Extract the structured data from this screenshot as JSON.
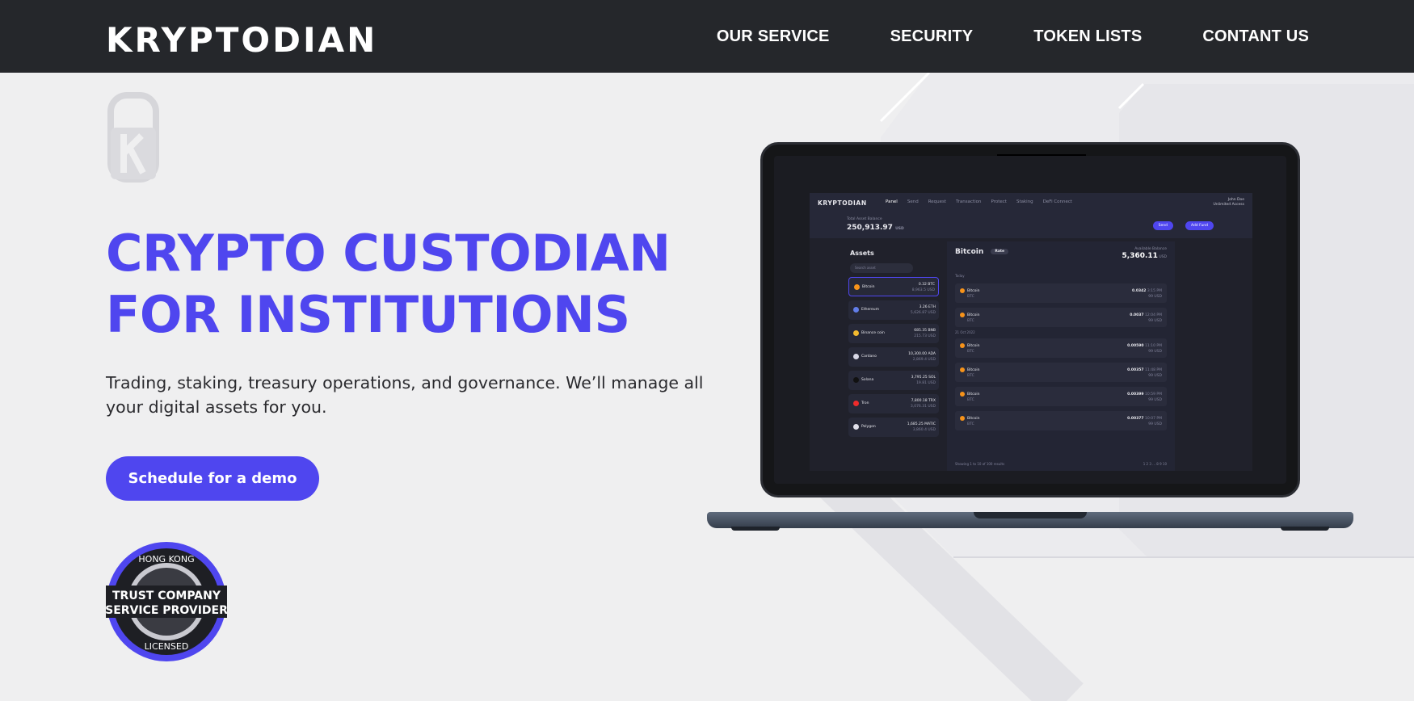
{
  "brand": {
    "logo_text": "KRYPTODIAN",
    "accent": "#4f46ef",
    "header_bg": "#25272b"
  },
  "nav": {
    "items": [
      {
        "label": "OUR SERVICE"
      },
      {
        "label": "SECURITY"
      },
      {
        "label": "TOKEN LISTS"
      },
      {
        "label": "CONTANT US"
      }
    ]
  },
  "hero": {
    "title_line1": "CRYPTO CUSTODIAN",
    "title_line2": "FOR INSTITUTIONS",
    "subtitle": "Trading, staking, treasury operations, and governance. We’ll manage all your digital assets for you.",
    "cta_label": "Schedule for a demo"
  },
  "badge": {
    "top_text": "HONG KONG",
    "line1": "TRUST COMPANY",
    "line2": "SERVICE PROVIDER",
    "bottom_text": "LICENSED"
  },
  "laptop_app": {
    "logo": "KRYPTODIAN",
    "tabs": [
      "Panel",
      "Send",
      "Request",
      "Transaction",
      "Protect",
      "Staking",
      "DeFi Connect"
    ],
    "user_name": "John Doe",
    "user_role": "Unlimited Access",
    "balance_label": "Total Asset Balance",
    "balance_value": "250,913.97",
    "balance_unit": "USD",
    "send_label": "Send",
    "add_fund_label": "Add Fund",
    "assets_title": "Assets",
    "search_placeholder": "Search asset",
    "assets": [
      {
        "name": "Bitcoin",
        "amount": "0.32 BTC",
        "usd": "8,963.5 USD",
        "color": "#f7931a"
      },
      {
        "name": "Ethereum",
        "amount": "3.26 ETH",
        "usd": "5,626.87 USD",
        "color": "#627eea"
      },
      {
        "name": "Binance coin",
        "amount": "685.35 BNB",
        "usd": "215.73 USD",
        "color": "#f3ba2f"
      },
      {
        "name": "Cardano",
        "amount": "10,300.00 ADA",
        "usd": "2,869.4 USD",
        "color": "#d8d8e6"
      },
      {
        "name": "Solana",
        "amount": "3,795.25 SOL",
        "usd": "19.81 USD",
        "color": "#111111"
      },
      {
        "name": "Tron",
        "amount": "7,800.18 TRX",
        "usd": "3,076.31 USD",
        "color": "#ef2b2b"
      },
      {
        "name": "Polygon",
        "amount": "1,685.25 MATIC",
        "usd": "3,860.4 USD",
        "color": "#e0e0ea"
      }
    ],
    "detail_title": "Bitcoin",
    "detail_tag": "Rate",
    "available_label": "Available Balance",
    "available_value": "5,360.11",
    "available_unit": "USD",
    "group_today": "Today",
    "group_date": "21 Oct 2022",
    "transactions": [
      {
        "name": "Bitcoin",
        "sub": "BTC",
        "amount": "0.0342",
        "time": "3:15 PM",
        "usd": "99 USD"
      },
      {
        "name": "Bitcoin",
        "sub": "BTC",
        "amount": "0.0037",
        "time": "12:04 PM",
        "usd": "99 USD"
      },
      {
        "name": "Bitcoin",
        "sub": "BTC",
        "amount": "0.00590",
        "time": "11:10 PM",
        "usd": "99 USD"
      },
      {
        "name": "Bitcoin",
        "sub": "BTC",
        "amount": "0.00357",
        "time": "11:48 PM",
        "usd": "99 USD"
      },
      {
        "name": "Bitcoin",
        "sub": "BTC",
        "amount": "0.00399",
        "time": "10:59 PM",
        "usd": "99 USD"
      },
      {
        "name": "Bitcoin",
        "sub": "BTC",
        "amount": "0.00377",
        "time": "10:07 PM",
        "usd": "99 USD"
      }
    ],
    "pager_text": "Showing 1 to 10 of 100 results",
    "pages": "1 2 3 ... 8 9 10"
  }
}
